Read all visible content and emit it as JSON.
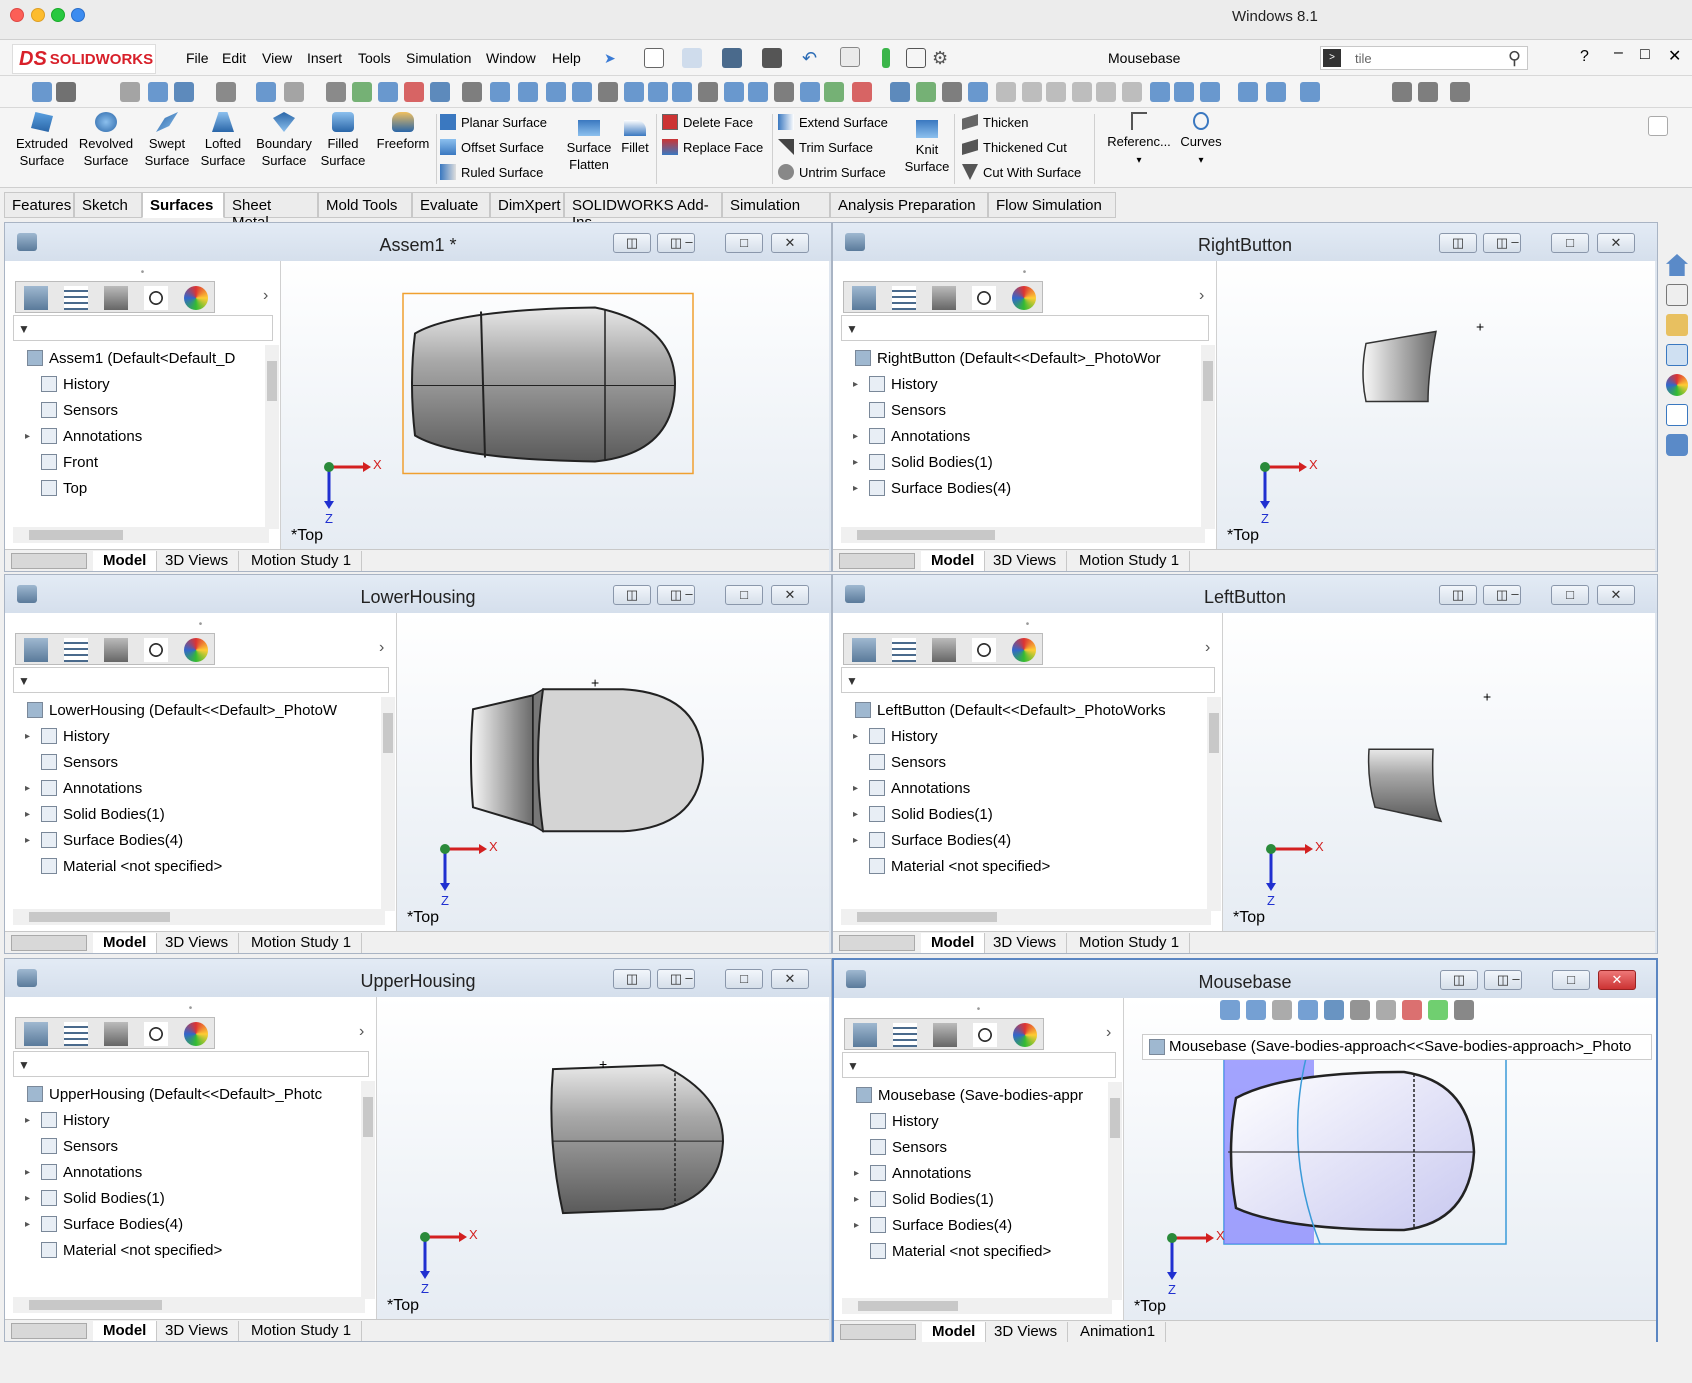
{
  "os_title": "Windows 8.1",
  "app": {
    "brand_ds": "DS",
    "brand_name": "SOLIDWORKS"
  },
  "menu": [
    "File",
    "Edit",
    "View",
    "Insert",
    "Tools",
    "Simulation",
    "Window",
    "Help"
  ],
  "doc_title": "Mousebase",
  "search": {
    "value": "tile"
  },
  "ribbon": {
    "big_buttons": [
      {
        "line1": "Extruded",
        "line2": "Surface"
      },
      {
        "line1": "Revolved",
        "line2": "Surface"
      },
      {
        "line1": "Swept",
        "line2": "Surface"
      },
      {
        "line1": "Lofted",
        "line2": "Surface"
      },
      {
        "line1": "Boundary",
        "line2": "Surface"
      },
      {
        "line1": "Filled",
        "line2": "Surface"
      },
      {
        "line1": "Freeform",
        "line2": ""
      }
    ],
    "col1": [
      "Planar Surface",
      "Offset Surface",
      "Ruled Surface"
    ],
    "flatten": {
      "line1": "Surface",
      "line2": "Flatten"
    },
    "fillet": "Fillet",
    "col2": [
      "Delete Face",
      "Replace Face"
    ],
    "col3": [
      "Extend Surface",
      "Trim Surface",
      "Untrim Surface"
    ],
    "knit": {
      "line1": "Knit",
      "line2": "Surface"
    },
    "col4": [
      "Thicken",
      "Thickened Cut",
      "Cut With Surface"
    ],
    "reference": "Referenc...",
    "curves": "Curves"
  },
  "tabs": [
    "Features",
    "Sketch",
    "Surfaces",
    "Sheet Metal",
    "Mold Tools",
    "Evaluate",
    "DimXpert",
    "SOLIDWORKS Add-Ins",
    "Simulation",
    "Analysis Preparation",
    "Flow Simulation"
  ],
  "active_tab": "Surfaces",
  "docs": [
    {
      "title": "Assem1 *",
      "root": "Assem1  (Default<Default_D",
      "items": [
        {
          "label": "History",
          "exp": ""
        },
        {
          "label": "Sensors",
          "exp": ""
        },
        {
          "label": "Annotations",
          "exp": "▸"
        },
        {
          "label": "Front",
          "exp": ""
        },
        {
          "label": "Top",
          "exp": ""
        }
      ],
      "orient": "*Top",
      "tabs": [
        "Model",
        "3D Views",
        "Motion Study 1"
      ]
    },
    {
      "title": "RightButton",
      "root": "RightButton  (Default<<Default>_PhotoWor",
      "items": [
        {
          "label": "History",
          "exp": "▸"
        },
        {
          "label": "Sensors",
          "exp": ""
        },
        {
          "label": "Annotations",
          "exp": "▸"
        },
        {
          "label": "Solid Bodies(1)",
          "exp": "▸"
        },
        {
          "label": "Surface Bodies(4)",
          "exp": "▸"
        }
      ],
      "orient": "*Top",
      "tabs": [
        "Model",
        "3D Views",
        "Motion Study 1"
      ]
    },
    {
      "title": "LowerHousing",
      "root": "LowerHousing  (Default<<Default>_PhotoW",
      "items": [
        {
          "label": "History",
          "exp": "▸"
        },
        {
          "label": "Sensors",
          "exp": ""
        },
        {
          "label": "Annotations",
          "exp": "▸"
        },
        {
          "label": "Solid Bodies(1)",
          "exp": "▸"
        },
        {
          "label": "Surface Bodies(4)",
          "exp": "▸"
        },
        {
          "label": "Material <not specified>",
          "exp": ""
        }
      ],
      "orient": "*Top",
      "tabs": [
        "Model",
        "3D Views",
        "Motion Study 1"
      ]
    },
    {
      "title": "LeftButton",
      "root": "LeftButton  (Default<<Default>_PhotoWorks",
      "items": [
        {
          "label": "History",
          "exp": "▸"
        },
        {
          "label": "Sensors",
          "exp": ""
        },
        {
          "label": "Annotations",
          "exp": "▸"
        },
        {
          "label": "Solid Bodies(1)",
          "exp": "▸"
        },
        {
          "label": "Surface Bodies(4)",
          "exp": "▸"
        },
        {
          "label": "Material <not specified>",
          "exp": ""
        }
      ],
      "orient": "*Top",
      "tabs": [
        "Model",
        "3D Views",
        "Motion Study 1"
      ]
    },
    {
      "title": "UpperHousing",
      "root": "UpperHousing  (Default<<Default>_Photc",
      "items": [
        {
          "label": "History",
          "exp": "▸"
        },
        {
          "label": "Sensors",
          "exp": ""
        },
        {
          "label": "Annotations",
          "exp": "▸"
        },
        {
          "label": "Solid Bodies(1)",
          "exp": "▸"
        },
        {
          "label": "Surface Bodies(4)",
          "exp": "▸"
        },
        {
          "label": "Material <not specified>",
          "exp": ""
        }
      ],
      "orient": "*Top",
      "tabs": [
        "Model",
        "3D Views",
        "Motion Study 1"
      ]
    },
    {
      "title": "Mousebase",
      "root": "Mousebase  (Save-bodies-appr",
      "items": [
        {
          "label": "History",
          "exp": ""
        },
        {
          "label": "Sensors",
          "exp": ""
        },
        {
          "label": "Annotations",
          "exp": "▸"
        },
        {
          "label": "Solid Bodies(1)",
          "exp": "▸"
        },
        {
          "label": "Surface Bodies(4)",
          "exp": "▸"
        },
        {
          "label": "Material <not specified>",
          "exp": ""
        }
      ],
      "orient": "*Top",
      "tabs": [
        "Model",
        "3D Views",
        "Animation1"
      ],
      "viewport_tree": "Mousebase  (Save-bodies-approach<<Save-bodies-approach>_Photo"
    }
  ],
  "triad": {
    "x": "X",
    "z": "Z"
  },
  "colors": {
    "brand": "#d8202a",
    "selection": "#f0a030",
    "active_border": "#5b86c2",
    "axis_x": "#d32020",
    "axis_z": "#2030d0",
    "highlight": "#7d7dff"
  },
  "icons": [
    "search-icon",
    "filter-icon",
    "close-icon",
    "minimize-icon",
    "maximize-icon",
    "tile-icon",
    "feature-manager-icon",
    "property-manager-icon",
    "config-manager-icon",
    "dimxpert-icon",
    "display-manager-icon"
  ]
}
